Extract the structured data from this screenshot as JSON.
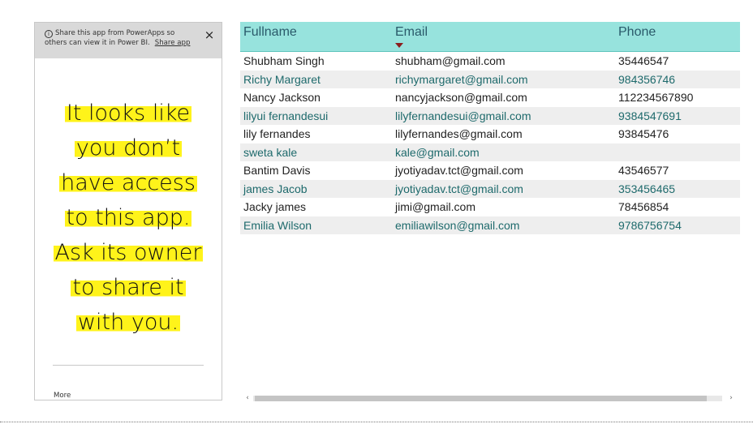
{
  "banner": {
    "text": "Share this app from PowerApps so others can view it in Power BI.",
    "share_link": "Share app",
    "info_icon": "i",
    "close_icon": "×"
  },
  "message": {
    "lines": [
      "It looks like",
      "you don’t",
      "have access",
      "to this app.",
      "Ask its owner",
      "to share it",
      "with you."
    ]
  },
  "footer": {
    "more_link": "More"
  },
  "table": {
    "columns": [
      "Fullname",
      "Email",
      "Phone"
    ],
    "sort_column": "Email",
    "rows": [
      [
        "Shubham Singh",
        "shubham@gmail.com",
        "35446547"
      ],
      [
        "Richy Margaret",
        "richymargaret@gmail.com",
        "984356746"
      ],
      [
        "Nancy Jackson",
        "nancyjackson@gmail.com",
        "112234567890"
      ],
      [
        "lilyui fernandesui",
        "lilyfernandesui@gmail.com",
        "9384547691"
      ],
      [
        "lily fernandes",
        "lilyfernandes@gmail.com",
        "93845476"
      ],
      [
        "sweta kale",
        "kale@gmail.com",
        ""
      ],
      [
        "Bantim Davis",
        "jyotiyadav.tct@gmail.com",
        "43546577"
      ],
      [
        "james Jacob",
        "jyotiyadav.tct@gmail.com",
        "353456465"
      ],
      [
        "Jacky james",
        "jimi@gmail.com",
        "78456854"
      ],
      [
        "Emilia Wilson",
        "emiliawilson@gmail.com",
        "9786756754"
      ]
    ]
  },
  "scrollbar": {
    "left_arrow": "‹",
    "right_arrow": "›"
  },
  "colors": {
    "header_bg": "#97e3dd",
    "highlight": "#fff31a",
    "alt_row_bg": "#eeeeee",
    "alt_row_text": "#1e6a6c",
    "sort_arrow": "#8b1d1d"
  }
}
